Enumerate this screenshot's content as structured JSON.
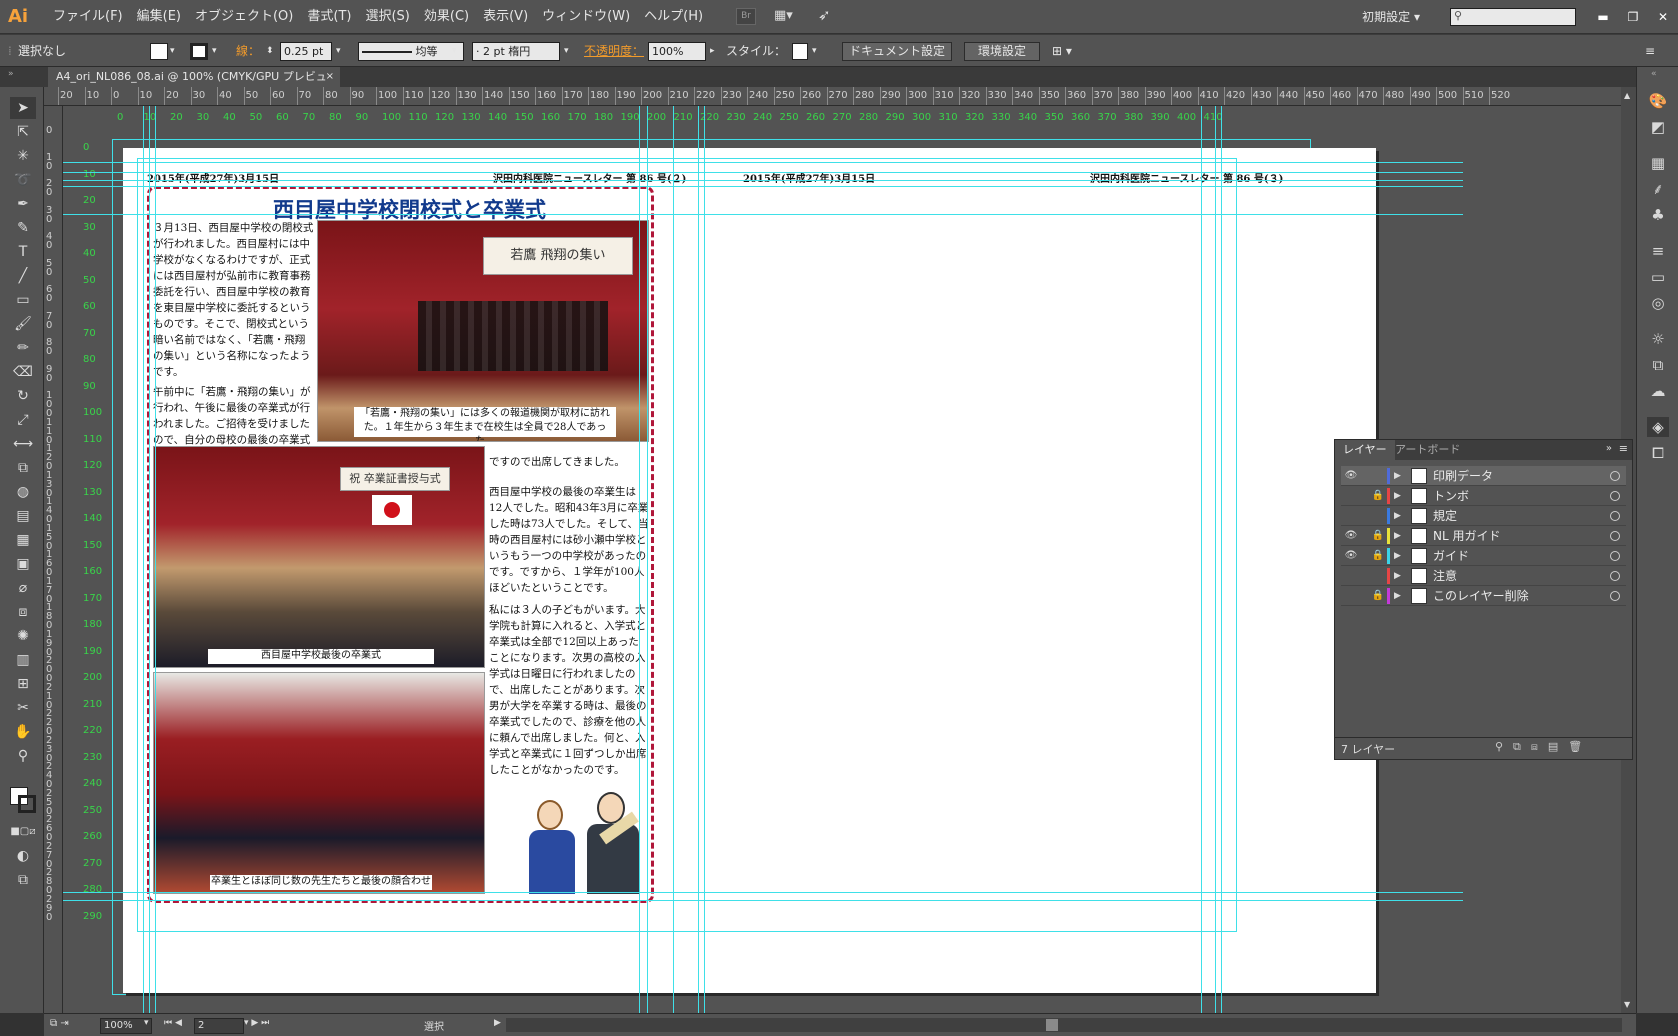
{
  "app": {
    "logo": "Ai"
  },
  "menu": [
    "ファイル(F)",
    "編集(E)",
    "オブジェクト(O)",
    "書式(T)",
    "選択(S)",
    "効果(C)",
    "表示(V)",
    "ウィンドウ(W)",
    "ヘルプ(H)"
  ],
  "workspace": "初期設定",
  "control": {
    "selection": "選択なし",
    "stroke_label": "線：",
    "stroke_value": "0.25 pt",
    "profile": "均等",
    "brush": "2 pt 楕円",
    "opacity_label": "不透明度：",
    "opacity_value": "100%",
    "style_label": "スタイル：",
    "doc_settings": "ドキュメント設定",
    "prefs": "環境設定"
  },
  "document_tab": "A4_ori_NL086_08.ai @ 100% (CMYK/GPU プレビュー)",
  "hruler_labels": [
    "20",
    "10",
    "0",
    "10",
    "20",
    "30",
    "40",
    "50",
    "60",
    "70",
    "80",
    "90",
    "100",
    "110",
    "120",
    "130",
    "140",
    "150",
    "160",
    "170",
    "180",
    "190",
    "200",
    "210",
    "220",
    "230",
    "240",
    "250",
    "260",
    "270",
    "280",
    "290",
    "300",
    "310",
    "320",
    "330",
    "340",
    "350",
    "360",
    "370",
    "380",
    "390",
    "400",
    "410",
    "420",
    "430",
    "440",
    "450",
    "460",
    "470",
    "480",
    "490",
    "500",
    "510",
    "520"
  ],
  "vruler_labels": [
    "0",
    "10",
    "20",
    "30",
    "40",
    "50",
    "60",
    "70",
    "80",
    "90",
    "100",
    "110",
    "120",
    "130",
    "140",
    "150",
    "160",
    "170",
    "180",
    "190",
    "200",
    "210",
    "220",
    "230",
    "240",
    "250",
    "260",
    "270",
    "280",
    "290"
  ],
  "artboard_ruler_labels": [
    "0",
    "10",
    "20",
    "30",
    "40",
    "50",
    "60",
    "70",
    "80",
    "90",
    "100",
    "110",
    "120",
    "130",
    "140",
    "150",
    "160",
    "170",
    "180",
    "190",
    "200",
    "210",
    "220",
    "230",
    "240",
    "250",
    "260",
    "270",
    "280",
    "290",
    "300",
    "310",
    "320",
    "330",
    "340",
    "350",
    "360",
    "370",
    "380",
    "390",
    "400",
    "410"
  ],
  "artboard_vruler_labels": [
    "0",
    "10",
    "20",
    "30",
    "40",
    "50",
    "60",
    "70",
    "80",
    "90",
    "100",
    "110",
    "120",
    "130",
    "140",
    "150",
    "160",
    "170",
    "180",
    "190",
    "200",
    "210",
    "220",
    "230",
    "240",
    "250",
    "260",
    "270",
    "280",
    "290"
  ],
  "newsletter": {
    "left_date": "2015年(平成27年)3月15日",
    "left_header": "沢田内科医院ニュースレター 第 86 号(２)",
    "right_date": "2015年(平成27年)3月15日",
    "right_header": "沢田内科医院ニュースレター 第 86 号(３)",
    "title": "西目屋中学校閉校式と卒業式",
    "para1": "３月13日、西目屋中学校の閉校式が行われました。西目屋村には中学校がなくなるわけですが、正式には西目屋村が弘前市に教育事務委託を行い、西目屋中学校の教育を東目屋中学校に委託するというものです。そこで、閉校式という暗い名前ではなく、「若鷹・飛翔の集い」という名称になったようです。",
    "para2": "午前中に「若鷹・飛翔の集い」が行われ、午後に最後の卒業式が行われました。ご招待を受けましたので、自分の母校の最後の卒業式",
    "para3": "ですので出席してきました。",
    "para4": "西目屋中学校の最後の卒業生は12人でした。昭和43年3月に卒業した時は73人でした。そして、当時の西目屋村には砂小瀬中学校というもう一つの中学校があったのです。ですから、１学年が100人ほどいたということです。",
    "para5": "私には３人の子どもがいます。大学院も計算に入れると、入学式と卒業式は全部で12回以上あったことになります。次男の高校の入学式は日曜日に行われましたので、出席したことがあります。次男が大学を卒業する時は、最後の卒業式でしたので、診療を他の人に頼んで出席しました。何と、入学式と卒業式に１回ずつしか出席したことがなかったのです。",
    "caption1": "「若鷹・飛翔の集い」には多くの報道機関が取材に訪れた。１年生から３年生まで在校生は全員で28人であった。",
    "caption2": "西目屋中学校最後の卒業式",
    "caption3": "卒業生とほぼ同じ数の先生たちと最後の顔合わせ",
    "banner1": "若鷹 飛翔の集い",
    "banner2": "祝 卒業証書授与式"
  },
  "layers_panel": {
    "tab_layers": "レイヤー",
    "tab_artboards": "アートボード",
    "footer": "7 レイヤー",
    "rows": [
      {
        "name": "印刷データ",
        "visible": true,
        "locked": false,
        "color": "#4f6bd9"
      },
      {
        "name": "トンボ",
        "visible": false,
        "locked": true,
        "color": "#e64545"
      },
      {
        "name": "規定",
        "visible": false,
        "locked": false,
        "color": "#3a7ae0"
      },
      {
        "name": "NL 用ガイド",
        "visible": true,
        "locked": true,
        "color": "#e8e23a"
      },
      {
        "name": "ガイド",
        "visible": true,
        "locked": true,
        "color": "#3ad4e8"
      },
      {
        "name": "注意",
        "visible": false,
        "locked": false,
        "color": "#e64545"
      },
      {
        "name": "このレイヤー削除",
        "visible": false,
        "locked": true,
        "color": "#c43ad8"
      }
    ]
  },
  "status": {
    "zoom": "100%",
    "artboard": "2",
    "tool": "選択"
  },
  "colors": {
    "guide": "#3fe0e8",
    "accent_orange": "#f29b2b",
    "title_blue": "#123a8c",
    "dashed_border": "#b0173a"
  }
}
